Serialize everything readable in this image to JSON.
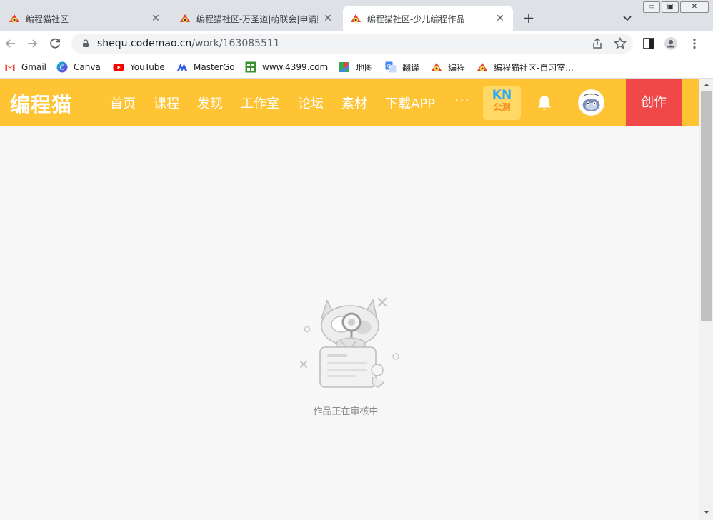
{
  "tabs": [
    {
      "title": "编程猫社区",
      "active": false
    },
    {
      "title": "编程猫社区-万圣道|萌联会|申请贴",
      "active": false
    },
    {
      "title": "编程猫社区-少儿编程作品",
      "active": true
    }
  ],
  "window_controls": {
    "minimize": "▭",
    "maximize": "▣",
    "close": "✕"
  },
  "address": {
    "host": "shequ.codemao.cn",
    "path": "/work/163085511"
  },
  "bookmarks": [
    {
      "label": "Gmail",
      "icon": "gmail-icon"
    },
    {
      "label": "Canva",
      "icon": "canva-icon"
    },
    {
      "label": "YouTube",
      "icon": "youtube-icon"
    },
    {
      "label": "MasterGo",
      "icon": "mastergo-icon"
    },
    {
      "label": "www.4399.com",
      "icon": "4399-icon"
    },
    {
      "label": "地图",
      "icon": "maps-icon"
    },
    {
      "label": "翻译",
      "icon": "translate-icon"
    },
    {
      "label": "编程",
      "icon": "codemao-icon"
    },
    {
      "label": "编程猫社区-自习室...",
      "icon": "codemao-icon"
    }
  ],
  "site": {
    "logo": "编程猫",
    "nav": [
      "首页",
      "课程",
      "发现",
      "工作室",
      "论坛",
      "素材",
      "下载APP"
    ],
    "more": "···",
    "kn_badge": {
      "line1": "KN",
      "line2": "公测"
    },
    "create_label": "创作",
    "brand_color": "#fec433",
    "create_color": "#f04848"
  },
  "content": {
    "status_text": "作品正在审核中"
  }
}
